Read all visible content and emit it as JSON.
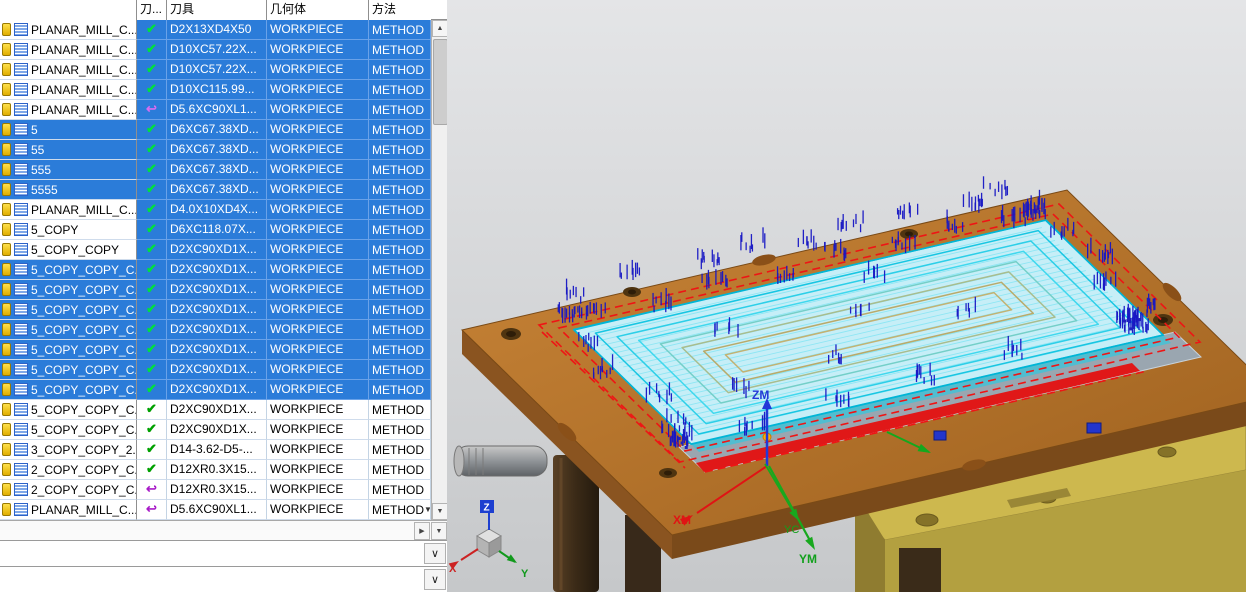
{
  "panel": {
    "headers": {
      "name": "",
      "status": "刀...",
      "tool": "刀具",
      "geometry": "几何体",
      "method": "方法"
    },
    "rows": [
      {
        "name": "PLANAR_MILL_C...",
        "status": "check",
        "tool": "D2X13XD4X50",
        "geometry": "WORKPIECE",
        "method": "METHOD",
        "name_selected": false,
        "cells_selected": true
      },
      {
        "name": "PLANAR_MILL_C...",
        "status": "check",
        "tool": "D10XC57.22X...",
        "geometry": "WORKPIECE",
        "method": "METHOD",
        "name_selected": false,
        "cells_selected": true
      },
      {
        "name": "PLANAR_MILL_C...",
        "status": "check",
        "tool": "D10XC57.22X...",
        "geometry": "WORKPIECE",
        "method": "METHOD",
        "name_selected": false,
        "cells_selected": true
      },
      {
        "name": "PLANAR_MILL_C...",
        "status": "check",
        "tool": "D10XC115.99...",
        "geometry": "WORKPIECE",
        "method": "METHOD",
        "name_selected": false,
        "cells_selected": true
      },
      {
        "name": "PLANAR_MILL_C...",
        "status": "regenerate",
        "tool": "D5.6XC90XL1...",
        "geometry": "WORKPIECE",
        "method": "METHOD",
        "name_selected": false,
        "cells_selected": true
      },
      {
        "name": "5",
        "status": "check",
        "tool": "D6XC67.38XD...",
        "geometry": "WORKPIECE",
        "method": "METHOD",
        "name_selected": true,
        "cells_selected": true
      },
      {
        "name": "55",
        "status": "check",
        "tool": "D6XC67.38XD...",
        "geometry": "WORKPIECE",
        "method": "METHOD",
        "name_selected": true,
        "cells_selected": true
      },
      {
        "name": "555",
        "status": "check",
        "tool": "D6XC67.38XD...",
        "geometry": "WORKPIECE",
        "method": "METHOD",
        "name_selected": true,
        "cells_selected": true
      },
      {
        "name": "5555",
        "status": "check",
        "tool": "D6XC67.38XD...",
        "geometry": "WORKPIECE",
        "method": "METHOD",
        "name_selected": true,
        "cells_selected": true
      },
      {
        "name": "PLANAR_MILL_C...",
        "status": "check",
        "tool": "D4.0X10XD4X...",
        "geometry": "WORKPIECE",
        "method": "METHOD",
        "name_selected": false,
        "cells_selected": true
      },
      {
        "name": "5_COPY",
        "status": "check",
        "tool": "D6XC118.07X...",
        "geometry": "WORKPIECE",
        "method": "METHOD",
        "name_selected": false,
        "cells_selected": true
      },
      {
        "name": "5_COPY_COPY",
        "status": "check",
        "tool": "D2XC90XD1X...",
        "geometry": "WORKPIECE",
        "method": "METHOD",
        "name_selected": false,
        "cells_selected": true
      },
      {
        "name": "5_COPY_COPY_C...",
        "status": "check",
        "tool": "D2XC90XD1X...",
        "geometry": "WORKPIECE",
        "method": "METHOD",
        "name_selected": true,
        "cells_selected": true
      },
      {
        "name": "5_COPY_COPY_C...",
        "status": "check",
        "tool": "D2XC90XD1X...",
        "geometry": "WORKPIECE",
        "method": "METHOD",
        "name_selected": true,
        "cells_selected": true
      },
      {
        "name": "5_COPY_COPY_C...",
        "status": "check",
        "tool": "D2XC90XD1X...",
        "geometry": "WORKPIECE",
        "method": "METHOD",
        "name_selected": true,
        "cells_selected": true
      },
      {
        "name": "5_COPY_COPY_C...",
        "status": "check",
        "tool": "D2XC90XD1X...",
        "geometry": "WORKPIECE",
        "method": "METHOD",
        "name_selected": true,
        "cells_selected": true
      },
      {
        "name": "5_COPY_COPY_C...",
        "status": "check",
        "tool": "D2XC90XD1X...",
        "geometry": "WORKPIECE",
        "method": "METHOD",
        "name_selected": true,
        "cells_selected": true
      },
      {
        "name": "5_COPY_COPY_C...",
        "status": "check",
        "tool": "D2XC90XD1X...",
        "geometry": "WORKPIECE",
        "method": "METHOD",
        "name_selected": true,
        "cells_selected": true
      },
      {
        "name": "5_COPY_COPY_C...",
        "status": "check",
        "tool": "D2XC90XD1X...",
        "geometry": "WORKPIECE",
        "method": "METHOD",
        "name_selected": true,
        "cells_selected": true
      },
      {
        "name": "5_COPY_COPY_C...",
        "status": "check",
        "tool": "D2XC90XD1X...",
        "geometry": "WORKPIECE",
        "method": "METHOD",
        "name_selected": false,
        "cells_selected": false
      },
      {
        "name": "5_COPY_COPY_C...",
        "status": "check",
        "tool": "D2XC90XD1X...",
        "geometry": "WORKPIECE",
        "method": "METHOD",
        "name_selected": false,
        "cells_selected": false
      },
      {
        "name": "3_COPY_COPY_2...",
        "status": "check",
        "tool": "D14-3.62-D5-...",
        "geometry": "WORKPIECE",
        "method": "METHOD",
        "name_selected": false,
        "cells_selected": false
      },
      {
        "name": "2_COPY_COPY_C...",
        "status": "check",
        "tool": "D12XR0.3X15...",
        "geometry": "WORKPIECE",
        "method": "METHOD",
        "name_selected": false,
        "cells_selected": false
      },
      {
        "name": "2_COPY_COPY_C...",
        "status": "regenerate",
        "tool": "D12XR0.3X15...",
        "geometry": "WORKPIECE",
        "method": "METHOD",
        "name_selected": false,
        "cells_selected": false
      },
      {
        "name": "PLANAR_MILL_C...",
        "status": "regenerate",
        "tool": "D5.6XC90XL1...",
        "geometry": "WORKPIECE",
        "method": "METHOD",
        "name_selected": false,
        "cells_selected": false,
        "has_chevron": true
      }
    ],
    "scrollbar": {
      "up": "▲",
      "down": "▼",
      "right": "▶",
      "pane_collapse": "∨"
    }
  },
  "icons": {
    "check": "✔",
    "regenerate": "↩",
    "dropdown": "▼"
  },
  "viewport": {
    "labels": {
      "zm": "ZM",
      "xm": "XM",
      "ym": "YM",
      "yc": "YC",
      "x": "X",
      "y": "Y",
      "z": "Z"
    },
    "colors": {
      "selection": "#2b7cd9",
      "check": "#00a000",
      "regenerate": "#a81cc8",
      "toolpath": "#00c0dc",
      "rapid": "#e81414",
      "traverse": "#1818c8",
      "plate": "#b9722e",
      "base_plate": "#c9b44e"
    }
  }
}
